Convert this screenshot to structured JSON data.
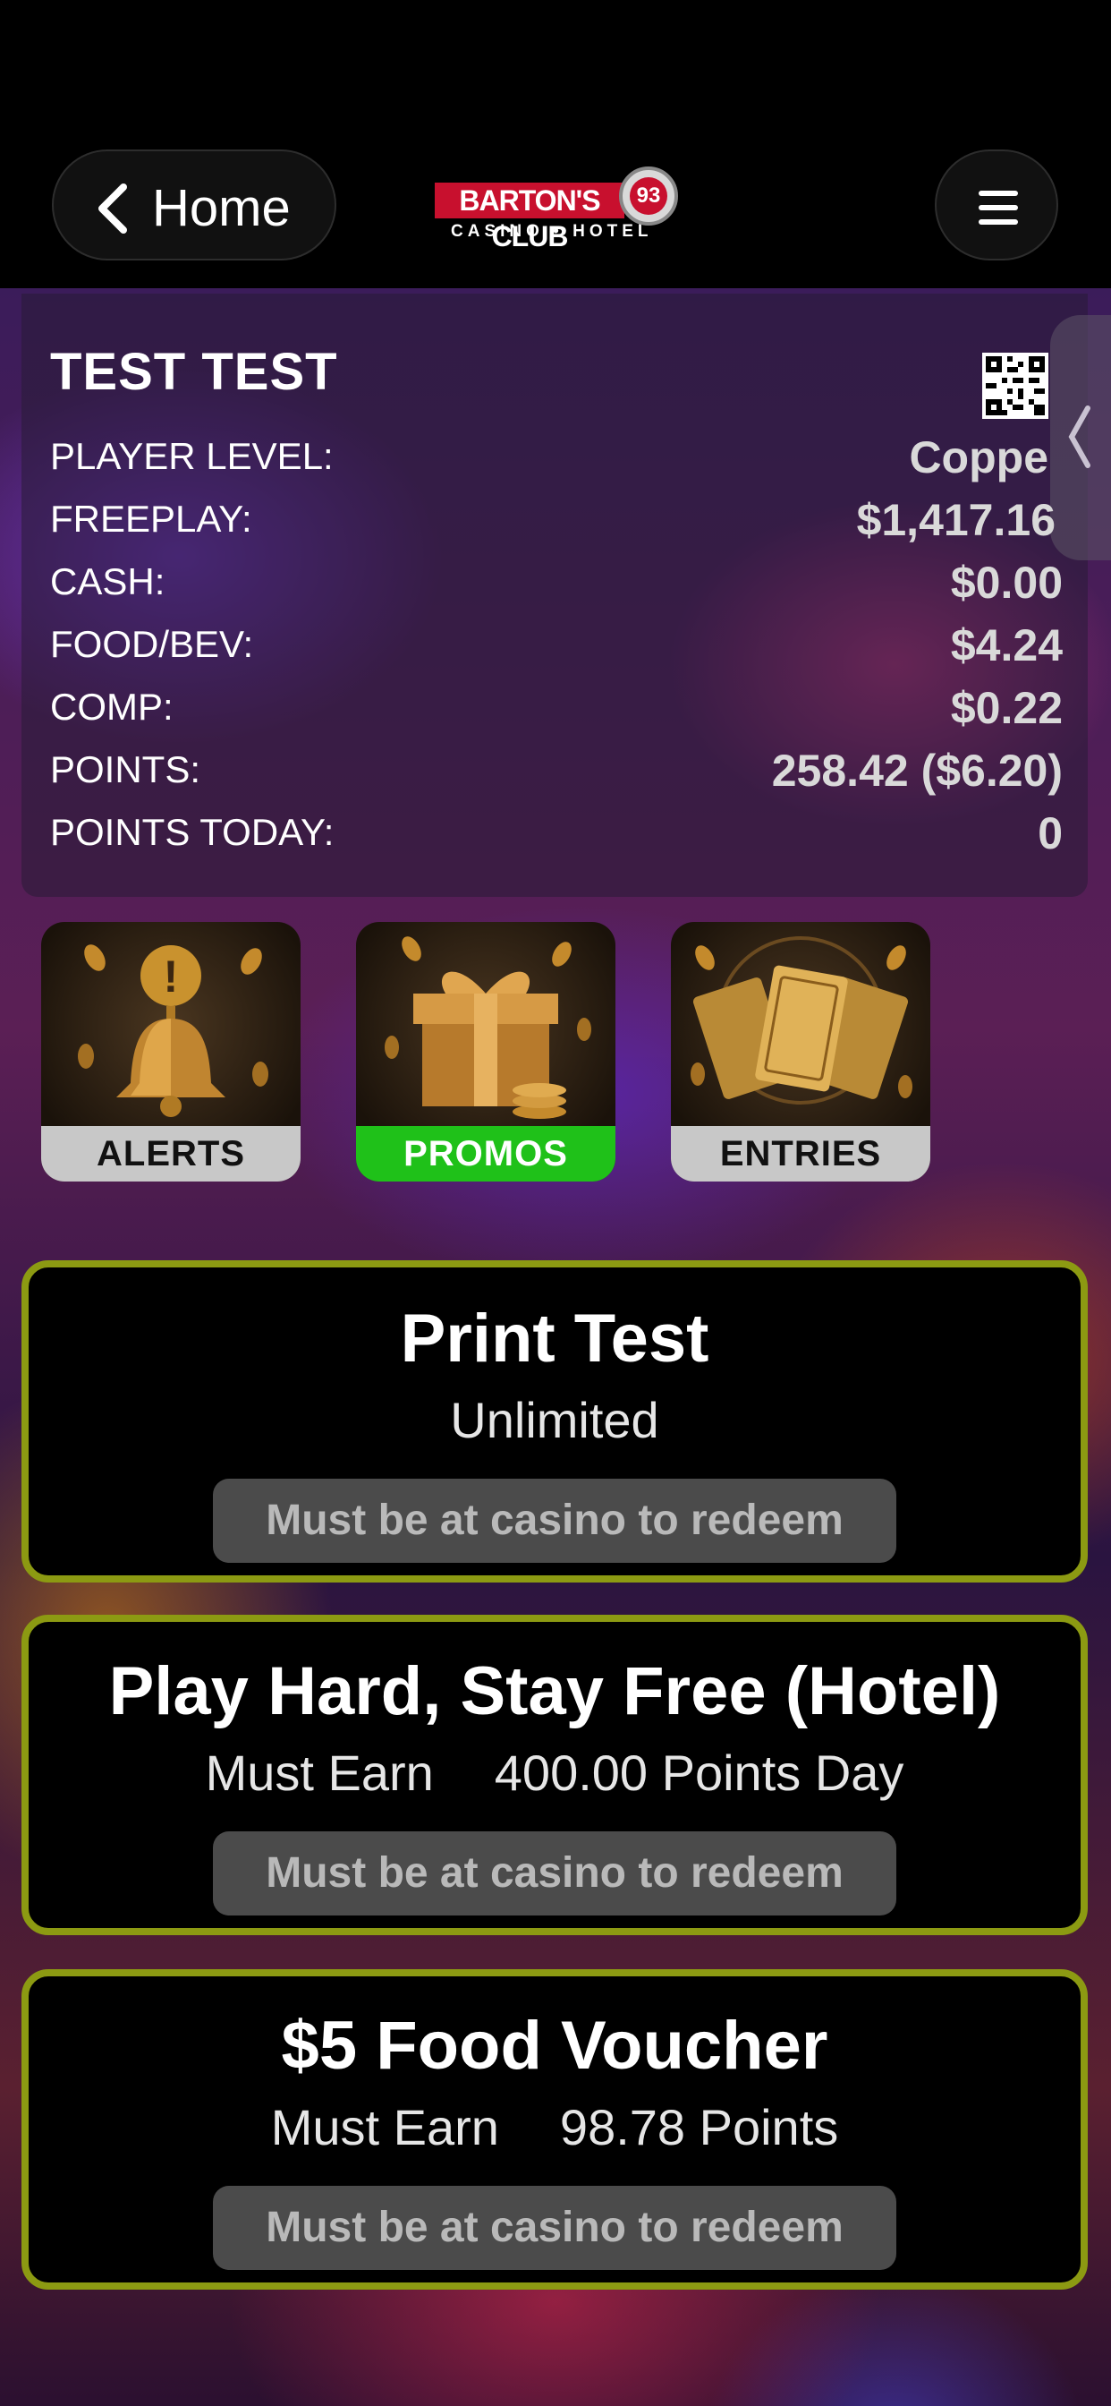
{
  "header": {
    "home_label": "Home",
    "logo": {
      "brand": "BARTON'S CLUB",
      "number": "93",
      "tagline": "CASINO • HOTEL"
    }
  },
  "account": {
    "name": "TEST TEST",
    "rows": [
      {
        "label": "PLAYER LEVEL:",
        "value": "Coppe"
      },
      {
        "label": "FREEPLAY:",
        "value": "$1,417.16"
      },
      {
        "label": "CASH:",
        "value": "$0.00"
      },
      {
        "label": "FOOD/BEV:",
        "value": "$4.24"
      },
      {
        "label": "COMP:",
        "value": "$0.22"
      },
      {
        "label": "POINTS:",
        "value": "258.42 ($6.20)"
      },
      {
        "label": "POINTS TODAY:",
        "value": "0"
      }
    ]
  },
  "tiles": [
    {
      "label": "ALERTS",
      "icon": "bell-icon"
    },
    {
      "label": "PROMOS",
      "icon": "gift-icon"
    },
    {
      "label": "ENTRIES",
      "icon": "ticket-icon"
    }
  ],
  "offers": [
    {
      "title": "Print Test",
      "sub": [
        "Unlimited"
      ],
      "redeem": "Must be at casino to redeem"
    },
    {
      "title": "Play Hard, Stay Free (Hotel)",
      "sub": [
        "Must Earn",
        "400.00 Points Day"
      ],
      "redeem": "Must be at casino to redeem"
    },
    {
      "title": "$5 Food Voucher",
      "sub": [
        "Must Earn",
        "98.78 Points"
      ],
      "redeem": "Must be at casino to redeem"
    }
  ],
  "colors": {
    "accent_border": "#8c9a12",
    "promos_green": "#1fc119",
    "brand_red": "#c8102e"
  }
}
